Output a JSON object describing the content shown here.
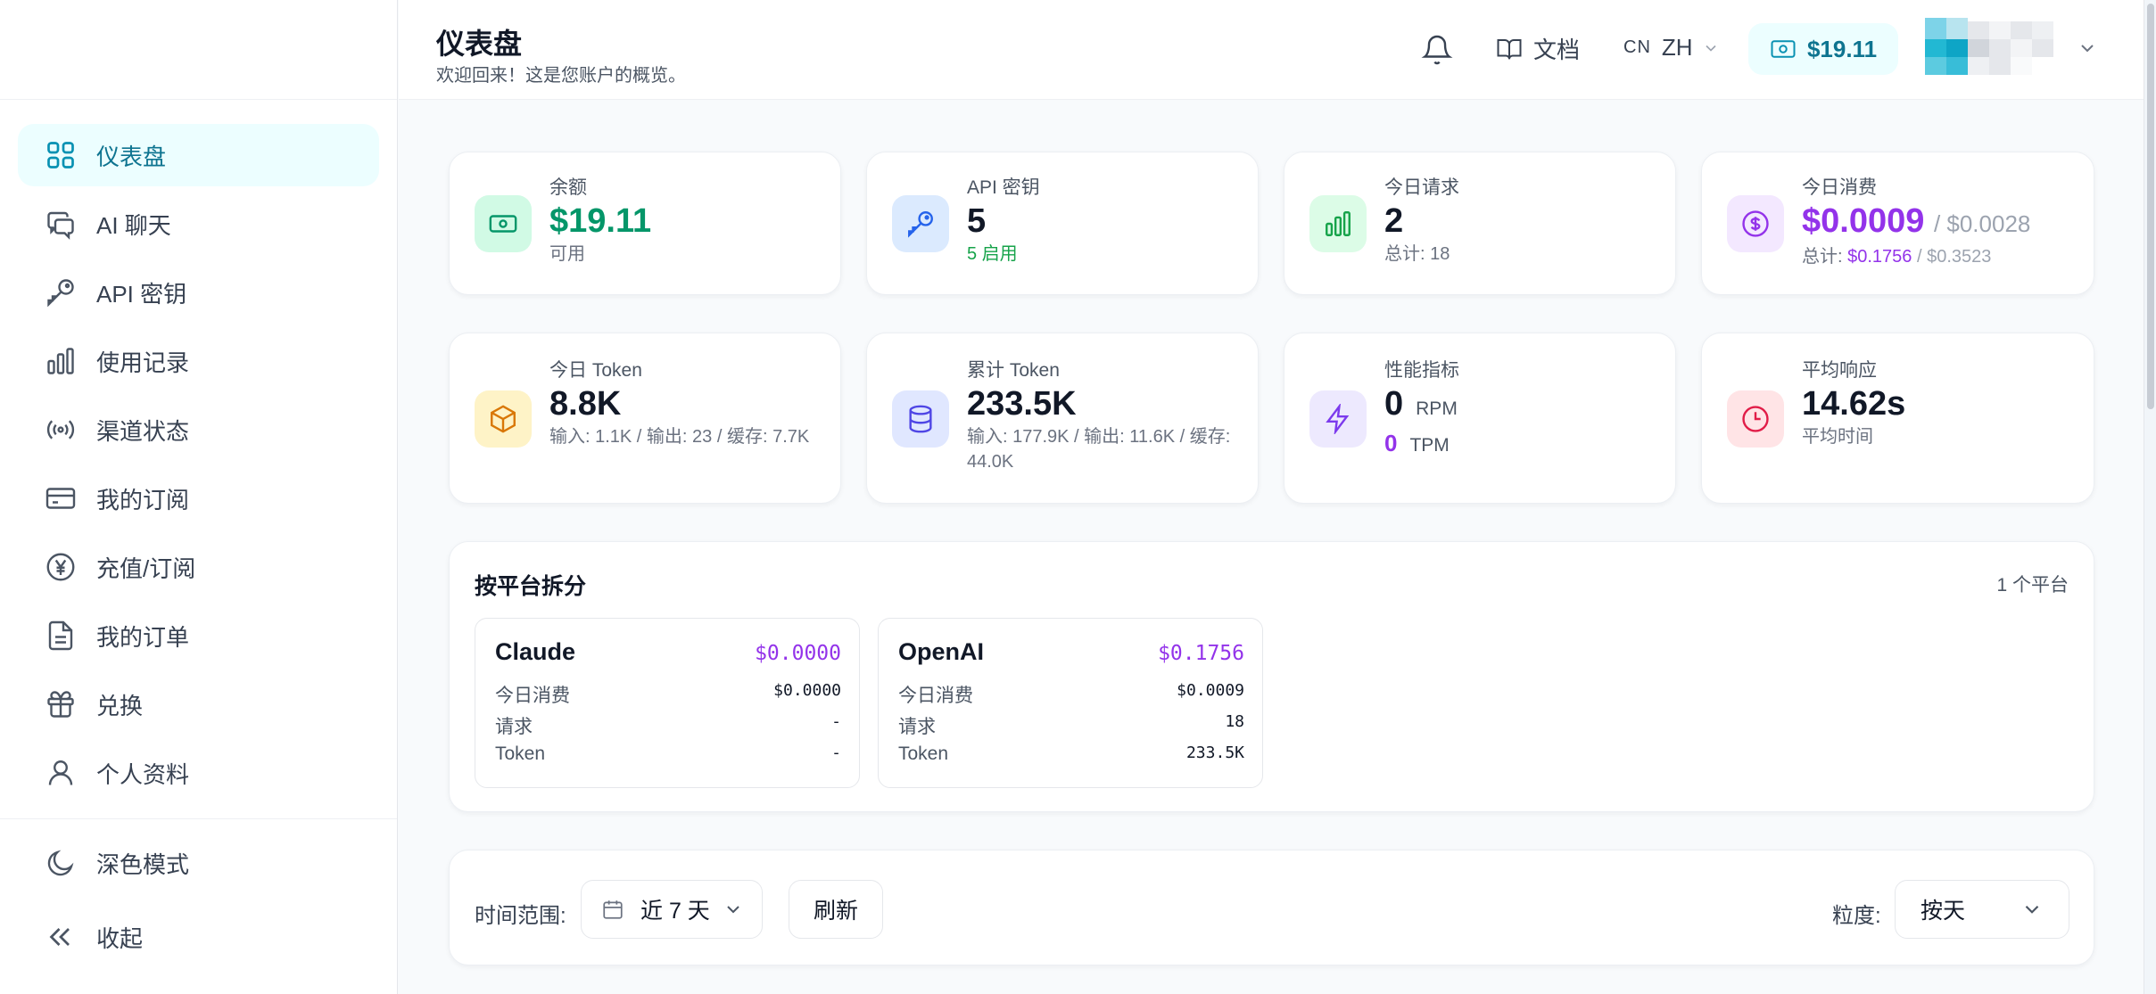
{
  "sidebar": {
    "items": [
      {
        "label": "仪表盘",
        "icon": "grid-icon"
      },
      {
        "label": "AI 聊天",
        "icon": "chat-icon"
      },
      {
        "label": "API 密钥",
        "icon": "key-icon"
      },
      {
        "label": "使用记录",
        "icon": "bar-chart-icon"
      },
      {
        "label": "渠道状态",
        "icon": "signal-icon"
      },
      {
        "label": "我的订阅",
        "icon": "credit-card-icon"
      },
      {
        "label": "充值/订阅",
        "icon": "yen-circle-icon"
      },
      {
        "label": "我的订单",
        "icon": "document-icon"
      },
      {
        "label": "兑换",
        "icon": "gift-icon"
      },
      {
        "label": "个人资料",
        "icon": "user-icon"
      }
    ],
    "dark_mode_label": "深色模式",
    "collapse_label": "收起"
  },
  "header": {
    "title": "仪表盘",
    "subtitle": "欢迎回来！这是您账户的概览。",
    "docs_label": "文档",
    "lang_flag": "CN",
    "lang_code": "ZH",
    "balance": "$19.11"
  },
  "stats": {
    "balance": {
      "label": "余额",
      "value": "$19.11",
      "sub": "可用"
    },
    "api_keys": {
      "label": "API 密钥",
      "value": "5",
      "sub": "5 启用"
    },
    "today_requests": {
      "label": "今日请求",
      "value": "2",
      "sub": "总计: 18"
    },
    "today_cost": {
      "label": "今日消费",
      "value": "$0.0009",
      "value_alt": "/ $0.0028",
      "sub_prefix": "总计: ",
      "sub_value": "$0.1756",
      "sub_alt": "/ $0.3523"
    },
    "today_tokens": {
      "label": "今日 Token",
      "value": "8.8K",
      "sub": "输入: 1.1K / 输出: 23 / 缓存: 7.7K"
    },
    "total_tokens": {
      "label": "累计 Token",
      "value": "233.5K",
      "sub": "输入: 177.9K / 输出: 11.6K / 缓存: 44.0K"
    },
    "performance": {
      "label": "性能指标",
      "rpm_value": "0",
      "rpm_unit": "RPM",
      "tpm_value": "0",
      "tpm_unit": "TPM"
    },
    "avg_response": {
      "label": "平均响应",
      "value": "14.62s",
      "sub": "平均时间"
    }
  },
  "platforms": {
    "title": "按平台拆分",
    "count": "1 个平台",
    "items": [
      {
        "name": "Claude",
        "total": "$0.0000",
        "today_cost_label": "今日消费",
        "today_cost": "$0.0000",
        "requests_label": "请求",
        "requests": "-",
        "tokens_label": "Token",
        "tokens": "-"
      },
      {
        "name": "OpenAI",
        "total": "$0.1756",
        "today_cost_label": "今日消费",
        "today_cost": "$0.0009",
        "requests_label": "请求",
        "requests": "18",
        "tokens_label": "Token",
        "tokens": "233.5K"
      }
    ]
  },
  "filters": {
    "range_label": "时间范围:",
    "range_value": "近 7 天",
    "refresh_label": "刷新",
    "granularity_label": "粒度:",
    "granularity_value": "按天"
  },
  "colors": {
    "accent": "#0891b2",
    "success": "#059669",
    "purple": "#9333ea",
    "muted": "#9ca3af"
  }
}
